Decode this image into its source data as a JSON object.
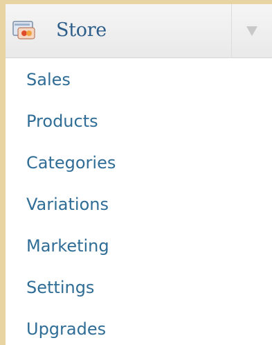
{
  "header": {
    "title": "Store",
    "icon": "store-icon",
    "toggle_icon": "triangle-down-icon"
  },
  "menu": {
    "items": [
      {
        "label": "Sales"
      },
      {
        "label": "Products"
      },
      {
        "label": "Categories"
      },
      {
        "label": "Variations"
      },
      {
        "label": "Marketing"
      },
      {
        "label": "Settings"
      },
      {
        "label": "Upgrades"
      }
    ]
  },
  "colors": {
    "link": "#2f6d96",
    "title": "#2e5e8a",
    "page_background": "#e8d3a3",
    "header_background": "#efefef"
  }
}
